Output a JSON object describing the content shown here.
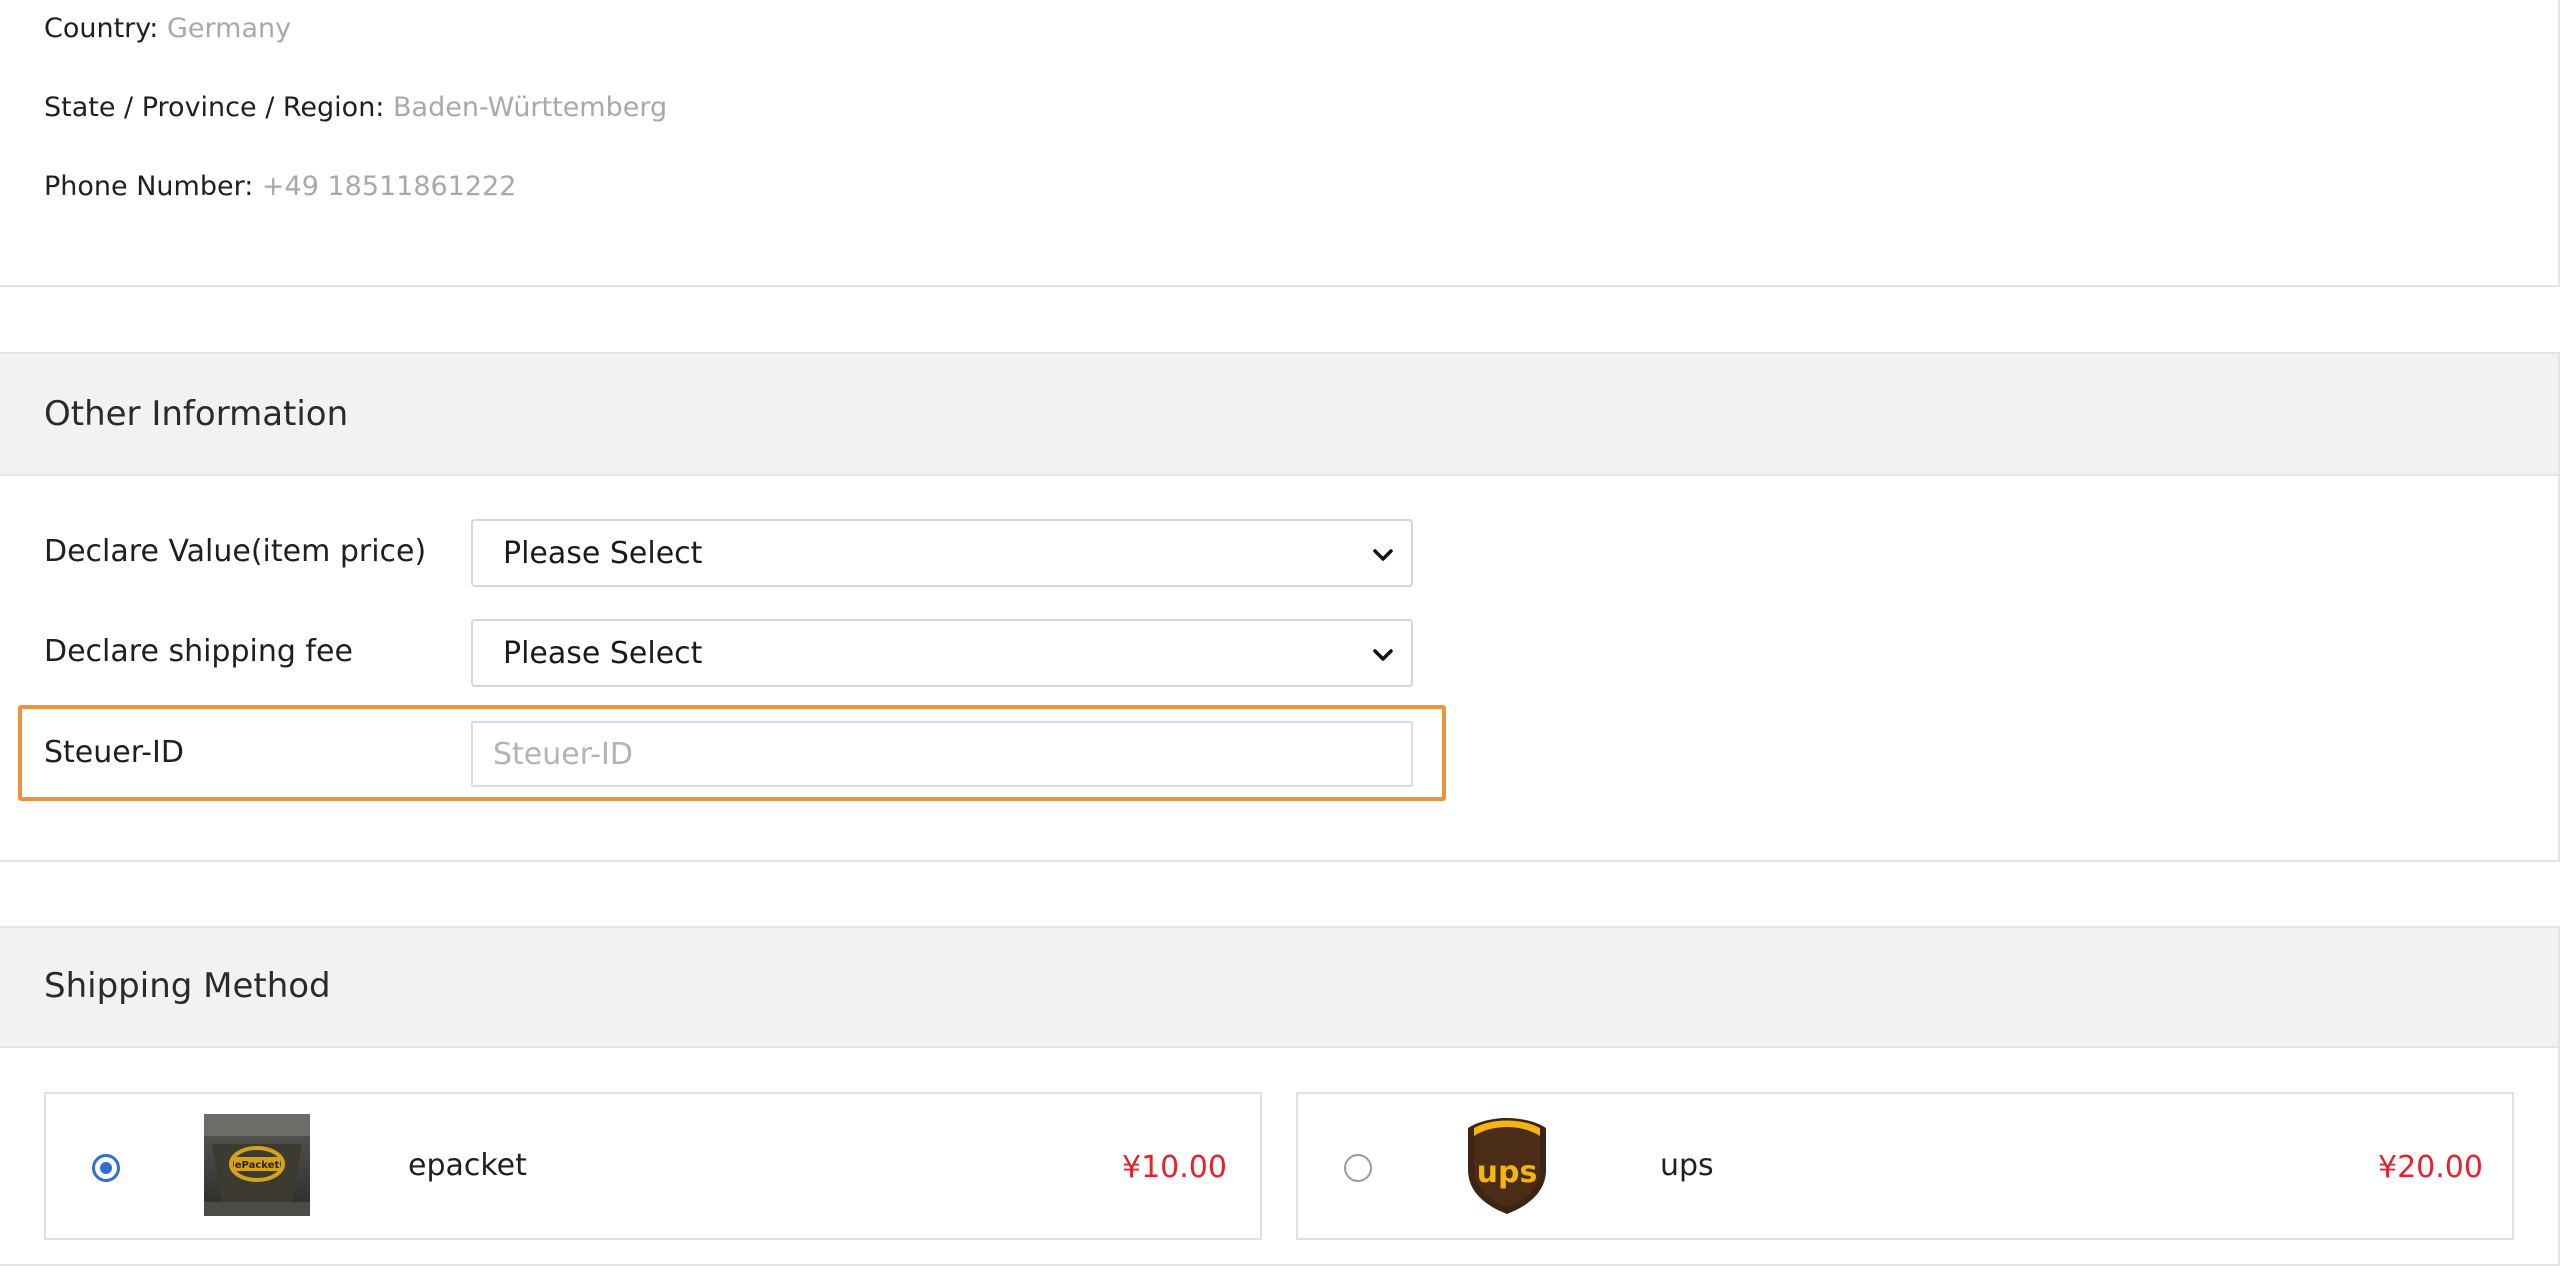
{
  "address": {
    "country_label": "Country:",
    "country_value": "Germany",
    "state_label": "State / Province / Region:",
    "state_value": "Baden-Württemberg",
    "phone_label": "Phone Number:",
    "phone_value": "+49 18511861222"
  },
  "other_information": {
    "title": "Other Information",
    "declare_value_label": "Declare Value(item price)",
    "declare_value_selected": "Please Select",
    "declare_shipping_label": "Declare shipping fee",
    "declare_shipping_selected": "Please Select",
    "steuer_label": "Steuer-ID",
    "steuer_placeholder": "Steuer-ID",
    "steuer_value": ""
  },
  "shipping_method": {
    "title": "Shipping Method",
    "options": [
      {
        "name": "epacket",
        "price": "¥10.00",
        "selected": true,
        "logo_text": "ePacket"
      },
      {
        "name": "ups",
        "price": "¥20.00",
        "selected": false,
        "logo_text": "ups"
      }
    ]
  },
  "colors": {
    "highlight": "#f0913d",
    "price": "#e8212d",
    "radio_selected": "#2f6fd1",
    "panel_header": "#f2f2f2"
  }
}
